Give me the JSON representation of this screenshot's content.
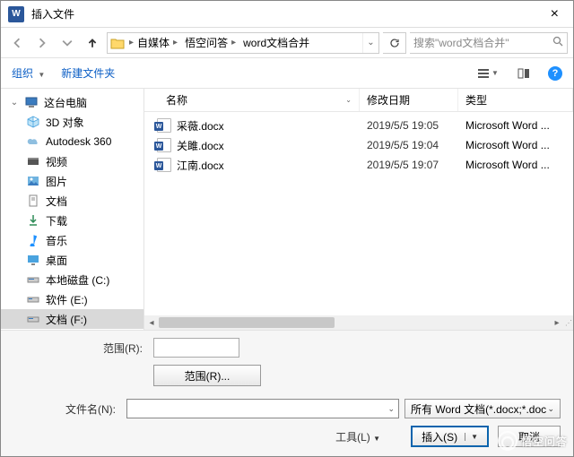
{
  "titlebar": {
    "title": "插入文件"
  },
  "breadcrumbs": {
    "b0": "自媒体",
    "b1": "悟空问答",
    "b2": "word文档合并"
  },
  "search": {
    "placeholder": "搜索\"word文档合并\""
  },
  "toolbar": {
    "organize": "组织",
    "newfolder": "新建文件夹"
  },
  "sidebar": {
    "items": [
      {
        "label": "这台电脑"
      },
      {
        "label": "3D 对象"
      },
      {
        "label": "Autodesk 360"
      },
      {
        "label": "视频"
      },
      {
        "label": "图片"
      },
      {
        "label": "文档"
      },
      {
        "label": "下载"
      },
      {
        "label": "音乐"
      },
      {
        "label": "桌面"
      },
      {
        "label": "本地磁盘 (C:)"
      },
      {
        "label": "软件 (E:)"
      },
      {
        "label": "文档 (F:)"
      }
    ]
  },
  "columns": {
    "name": "名称",
    "date": "修改日期",
    "type": "类型"
  },
  "files": [
    {
      "name": "采薇.docx",
      "date": "2019/5/5 19:05",
      "type": "Microsoft Word ..."
    },
    {
      "name": "关雎.docx",
      "date": "2019/5/5 19:04",
      "type": "Microsoft Word ..."
    },
    {
      "name": "江南.docx",
      "date": "2019/5/5 19:07",
      "type": "Microsoft Word ..."
    }
  ],
  "footer": {
    "range_label": "范围(R):",
    "range_btn": "范围(R)...",
    "filename_label": "文件名(N):",
    "filetype": "所有 Word 文档(*.docx;*.doc",
    "tools": "工具(L)",
    "insert": "插入(S)",
    "cancel": "取消"
  },
  "watermark": "悟空问答"
}
